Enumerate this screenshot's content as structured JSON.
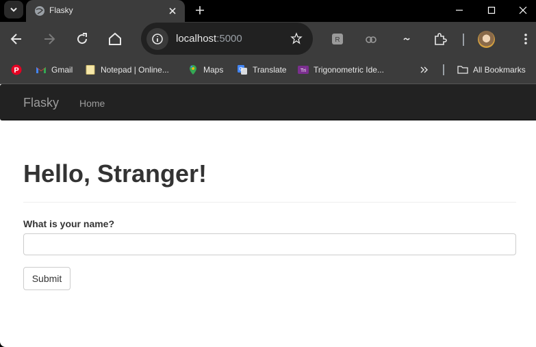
{
  "browser": {
    "tab": {
      "title": "Flasky"
    },
    "address": {
      "host": "localhost",
      "port": ":5000"
    },
    "bookmarks": [
      {
        "label": "",
        "icon": "pinterest-icon"
      },
      {
        "label": "Gmail",
        "icon": "gmail-icon"
      },
      {
        "label": "Notepad | Online...",
        "icon": "notepad-icon"
      },
      {
        "label": "Maps",
        "icon": "maps-icon"
      },
      {
        "label": "Translate",
        "icon": "translate-icon"
      },
      {
        "label": "Trigonometric Ide...",
        "icon": "trig-icon"
      }
    ],
    "all_bookmarks": "All Bookmarks",
    "colors": {
      "toolbar": "#3c3c3c",
      "tabbar": "#000000",
      "omnibox": "#212121"
    }
  },
  "page": {
    "navbar": {
      "brand": "Flasky",
      "home": "Home",
      "bg": "#222222"
    },
    "heading": "Hello, Stranger!",
    "form": {
      "label": "What is your name?",
      "name_value": "",
      "submit": "Submit"
    }
  }
}
